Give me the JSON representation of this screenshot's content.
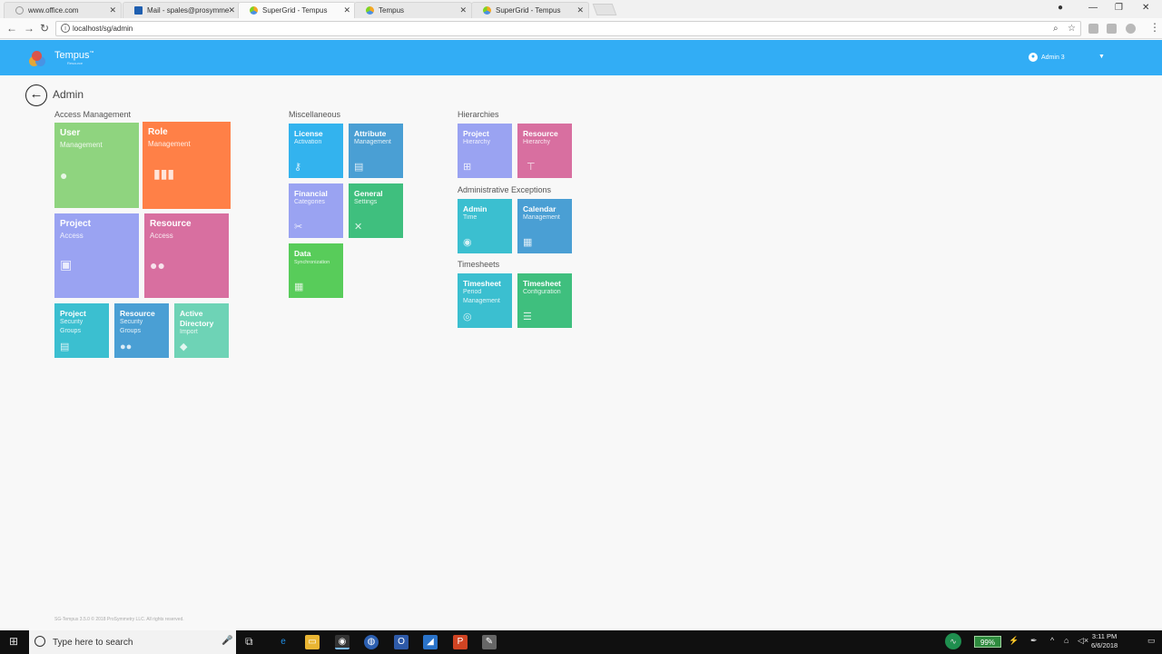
{
  "browser": {
    "tabs": [
      {
        "label": "www.office.com",
        "active": false
      },
      {
        "label": "Mail - spales@prosymme",
        "active": false
      },
      {
        "label": "SuperGrid - Tempus",
        "active": true
      },
      {
        "label": "Tempus",
        "active": false
      },
      {
        "label": "SuperGrid - Tempus",
        "active": false
      }
    ],
    "url": "localhost/sg/admin"
  },
  "app": {
    "brand": "Tempus",
    "brand_mark": "™",
    "brand_sub": "Resource",
    "user": "Admin 3"
  },
  "page": {
    "title": "Admin",
    "footer": "SG-Tempus 3.5.0 © 2018 ProSymmetry LLC. All rights reserved."
  },
  "sections": {
    "access": "Access Management",
    "misc": "Miscellaneous",
    "hier": "Hierarchies",
    "exceptions": "Administrative Exceptions",
    "timesheets": "Timesheets"
  },
  "tiles": {
    "user": {
      "title": "User",
      "sub": "Management"
    },
    "role": {
      "title": "Role",
      "sub": "Management"
    },
    "project_access": {
      "title": "Project",
      "sub": "Access"
    },
    "resource_access": {
      "title": "Resource",
      "sub": "Access"
    },
    "project_security": {
      "title": "Project",
      "sub": "Security Groups"
    },
    "resource_security": {
      "title": "Resource",
      "sub": "Security Groups"
    },
    "ad_import": {
      "title": "Active Directory",
      "sub": "Import"
    },
    "license": {
      "title": "License",
      "sub": "Activation"
    },
    "attribute": {
      "title": "Attribute",
      "sub": "Management"
    },
    "financial": {
      "title": "Financial",
      "sub": "Categories"
    },
    "general": {
      "title": "General",
      "sub": "Settings"
    },
    "data_sync": {
      "title": "Data",
      "sub": "Synchronization"
    },
    "project_hier": {
      "title": "Project",
      "sub": "Hierarchy"
    },
    "resource_hier": {
      "title": "Resource",
      "sub": "Hierarchy"
    },
    "admin_time": {
      "title": "Admin",
      "sub": "Time"
    },
    "calendar": {
      "title": "Calendar",
      "sub": "Management"
    },
    "ts_period": {
      "title": "Timesheet",
      "sub": "Period Management"
    },
    "ts_config": {
      "title": "Timesheet",
      "sub": "Configuration"
    }
  },
  "taskbar": {
    "search_placeholder": "Type here to search",
    "battery": "99%",
    "time": "3:11 PM",
    "date": "6/6/2018"
  },
  "colors": {
    "header": "#32adf5",
    "green": "#8fd47f",
    "orange": "#ff8047",
    "lavender": "#9aa3f2",
    "pink": "#d86fa0",
    "teal": "#3bbfd0",
    "steel": "#4a9fd4",
    "mint": "#6ed3b6",
    "sky": "#33b3ee",
    "emerald": "#3fbf7e",
    "lime": "#58cc5a"
  }
}
